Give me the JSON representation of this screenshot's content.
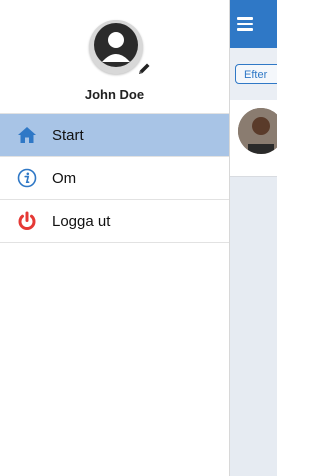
{
  "drawer": {
    "user_name": "John Doe",
    "menu": [
      {
        "label": "Start",
        "icon": "home-icon",
        "active": true
      },
      {
        "label": "Om",
        "icon": "info-icon",
        "active": false
      },
      {
        "label": "Logga ut",
        "icon": "power-icon",
        "active": false
      }
    ]
  },
  "main": {
    "filter_label": "Efter"
  },
  "colors": {
    "accent": "#2f78c6",
    "active_row": "#a8c4e6",
    "logout_red": "#e53935"
  }
}
